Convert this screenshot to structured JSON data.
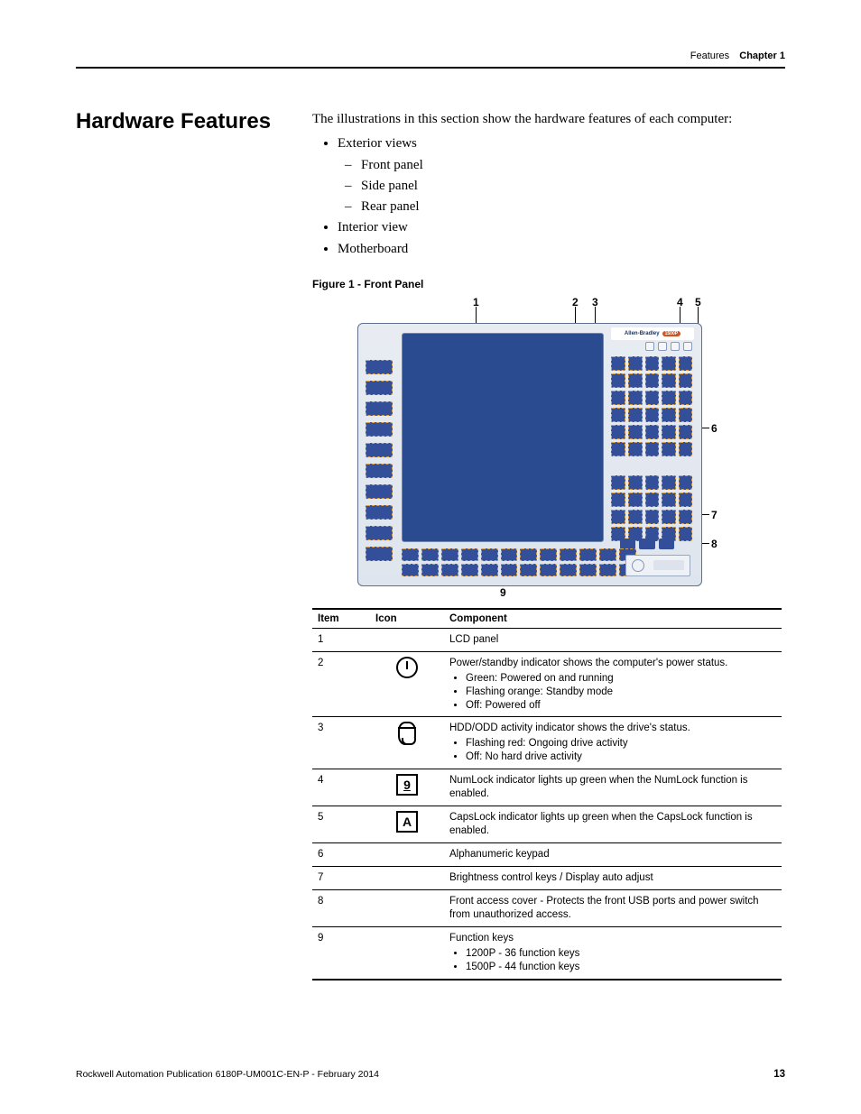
{
  "header": {
    "section": "Features",
    "chapter": "Chapter 1"
  },
  "sideHeading": "Hardware Features",
  "intro": "The illustrations in this section show the hardware features of each computer:",
  "bullets": {
    "b1": "Exterior views",
    "b1a": "Front panel",
    "b1b": "Side panel",
    "b1c": "Rear panel",
    "b2": "Interior view",
    "b3": "Motherboard"
  },
  "figureCaption": "Figure 1 - Front Panel",
  "figureBrand": "Allen-Bradley",
  "figureBrandPill": "1500P",
  "callouts": {
    "c1": "1",
    "c2": "2",
    "c3": "3",
    "c4": "4",
    "c5": "5",
    "c6": "6",
    "c7": "7",
    "c8": "8",
    "c9": "9"
  },
  "table": {
    "headers": {
      "item": "Item",
      "icon": "Icon",
      "component": "Component"
    },
    "rows": [
      {
        "item": "1",
        "iconType": "",
        "lead": "LCD panel",
        "list": []
      },
      {
        "item": "2",
        "iconType": "power",
        "lead": "Power/standby indicator shows the computer's power status.",
        "list": [
          "Green: Powered on and running",
          "Flashing orange: Standby mode",
          "Off: Powered off"
        ]
      },
      {
        "item": "3",
        "iconType": "drive",
        "lead": "HDD/ODD activity indicator shows the drive's status.",
        "list": [
          "Flashing red: Ongoing drive activity",
          "Off: No hard drive activity"
        ]
      },
      {
        "item": "4",
        "iconType": "num9",
        "lead": "NumLock indicator lights up green when the NumLock function is enabled.",
        "list": []
      },
      {
        "item": "5",
        "iconType": "capA",
        "lead": "CapsLock indicator lights up green when the CapsLock function is enabled.",
        "list": []
      },
      {
        "item": "6",
        "iconType": "",
        "lead": "Alphanumeric keypad",
        "list": []
      },
      {
        "item": "7",
        "iconType": "",
        "lead": "Brightness control keys / Display auto adjust",
        "list": []
      },
      {
        "item": "8",
        "iconType": "",
        "lead": "Front access cover - Protects the front USB ports and power switch from unauthorized access.",
        "list": []
      },
      {
        "item": "9",
        "iconType": "",
        "lead": "Function keys",
        "list": [
          "1200P - 36 function keys",
          "1500P - 44 function keys"
        ]
      }
    ]
  },
  "chart_data": {
    "type": "table",
    "title": "Figure 1 - Front Panel components",
    "columns": [
      "Item",
      "Icon",
      "Component"
    ],
    "rows": [
      [
        "1",
        "",
        "LCD panel"
      ],
      [
        "2",
        "power-icon",
        "Power/standby indicator shows the computer's power status. • Green: Powered on and running • Flashing orange: Standby mode • Off: Powered off"
      ],
      [
        "3",
        "drive-icon",
        "HDD/ODD activity indicator shows the drive's status. • Flashing red: Ongoing drive activity • Off: No hard drive activity"
      ],
      [
        "4",
        "numlock-9-icon",
        "NumLock indicator lights up green when the NumLock function is enabled."
      ],
      [
        "5",
        "capslock-A-icon",
        "CapsLock indicator lights up green when the CapsLock function is enabled."
      ],
      [
        "6",
        "",
        "Alphanumeric keypad"
      ],
      [
        "7",
        "",
        "Brightness control keys / Display auto adjust"
      ],
      [
        "8",
        "",
        "Front access cover - Protects the front USB ports and power switch from unauthorized access."
      ],
      [
        "9",
        "",
        "Function keys • 1200P - 36 function keys • 1500P - 44 function keys"
      ]
    ]
  },
  "footer": {
    "pub": "Rockwell Automation Publication 6180P-UM001C-EN-P - February 2014",
    "page": "13"
  }
}
